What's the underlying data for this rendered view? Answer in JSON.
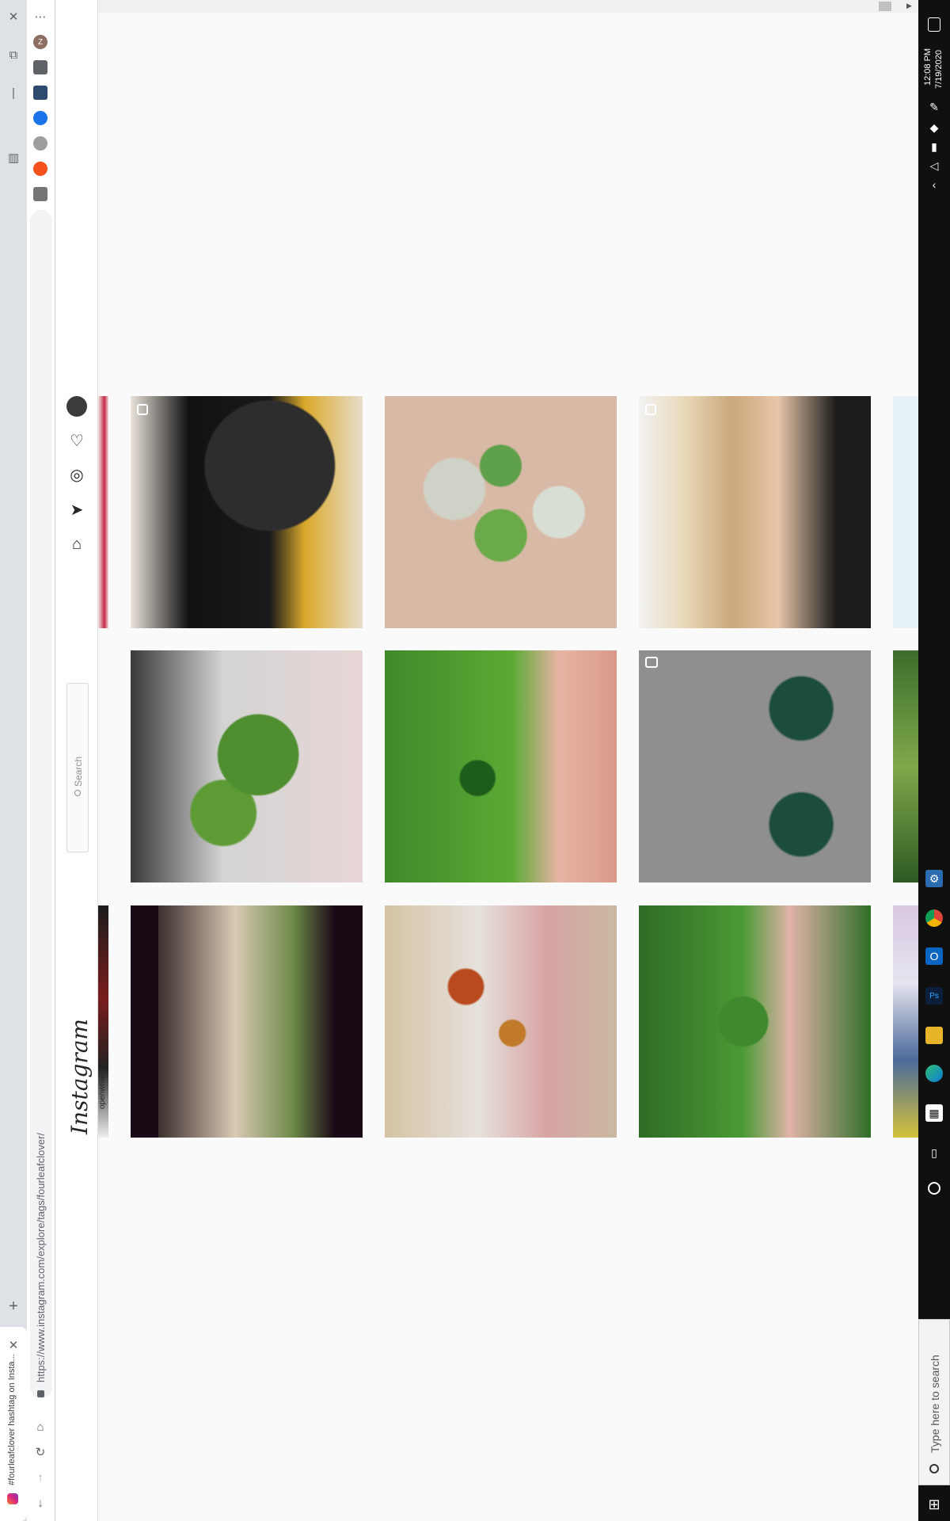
{
  "browser": {
    "tab_title": "#fourleafclover hashtag on Insta...",
    "url": "https://www.instagram.com/explore/tags/fourleafclover/",
    "profile_initial": "Z"
  },
  "instagram": {
    "logo": "Instagram",
    "search_placeholder": "Search",
    "partial_caption": "openwriter"
  },
  "taskbar": {
    "time": "12:08 PM",
    "date": "7/19/2020",
    "search_text": "Type here to search"
  },
  "icons": [
    "close-icon",
    "more-icon",
    "collections-icon",
    "minimize-icon",
    "split-view-icon",
    "new-tab-icon",
    "back-icon",
    "forward-icon",
    "reload-icon",
    "home-icon",
    "lock-icon",
    "home-nav-icon",
    "direct-icon",
    "explore-icon",
    "activity-icon",
    "avatar",
    "windows-start-icon",
    "search-icon",
    "cortana-icon",
    "task-view-icon",
    "notification-icon"
  ],
  "colors": {
    "ig_background": "#fafafa",
    "taskbar": "#101010",
    "clover_green": "#3f8a2e"
  }
}
